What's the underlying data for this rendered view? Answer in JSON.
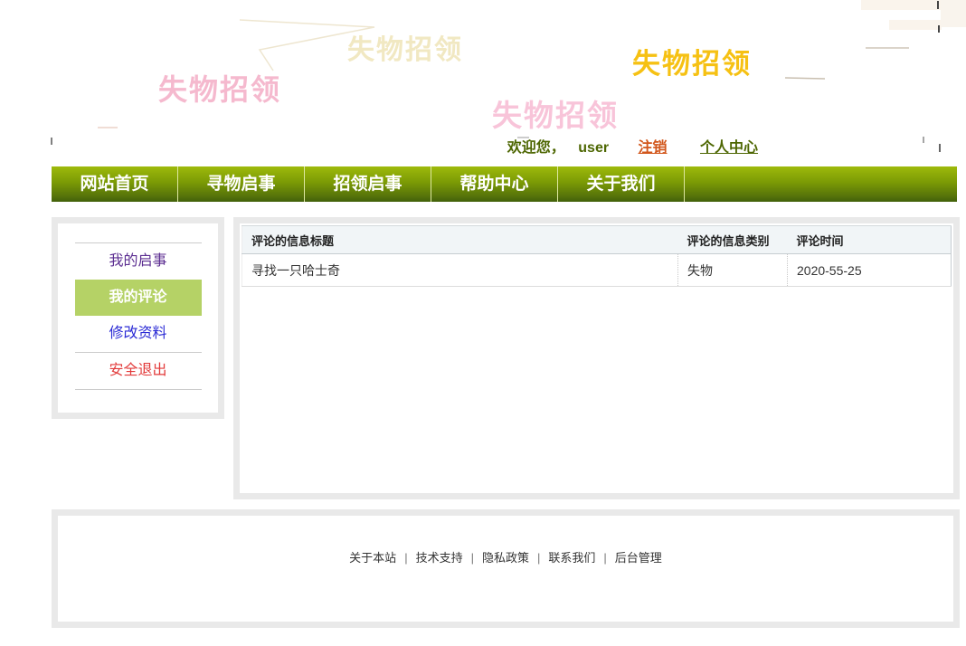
{
  "brand": {
    "watermarks": [
      {
        "text": "失物招领",
        "color": "#f1e8c2"
      },
      {
        "text": "失物招领",
        "color": "#f5b9ce"
      },
      {
        "text": "失物招领",
        "color": "#f6c113"
      },
      {
        "text": "失物招领",
        "color": "#f8c4d9"
      }
    ]
  },
  "user_bar": {
    "welcome_prefix": "欢迎您，",
    "username": "user",
    "logout_label": "注销",
    "profile_label": "个人中心"
  },
  "nav": {
    "items": [
      {
        "label": "网站首页"
      },
      {
        "label": "寻物启事"
      },
      {
        "label": "招领启事"
      },
      {
        "label": "帮助中心"
      },
      {
        "label": "关于我们"
      }
    ]
  },
  "sidebar": {
    "items": [
      {
        "label": "我的启事",
        "active": false
      },
      {
        "label": "我的评论",
        "active": true
      },
      {
        "label": "修改资料",
        "active": false
      },
      {
        "label": "安全退出",
        "active": false
      }
    ]
  },
  "comments": {
    "columns": [
      "评论的信息标题",
      "评论的信息类别",
      "评论时间"
    ],
    "rows": [
      {
        "title": "寻找一只哈士奇",
        "type": "失物",
        "time": "2020-55-25"
      }
    ]
  },
  "footer": {
    "separator": "|",
    "links": [
      "关于本站",
      "技术支持",
      "隐私政策",
      "联系我们",
      "后台管理"
    ]
  },
  "colors": {
    "nav_gradient_top": "#9eba0b",
    "nav_gradient_bottom": "#41600a",
    "sidebar_active_bg": "#b5d266",
    "welcome_text": "#4e6703",
    "logout_link": "#d2571c",
    "table_header_bg": "#f1f5f7",
    "frame_gray": "#e9e9e9"
  }
}
